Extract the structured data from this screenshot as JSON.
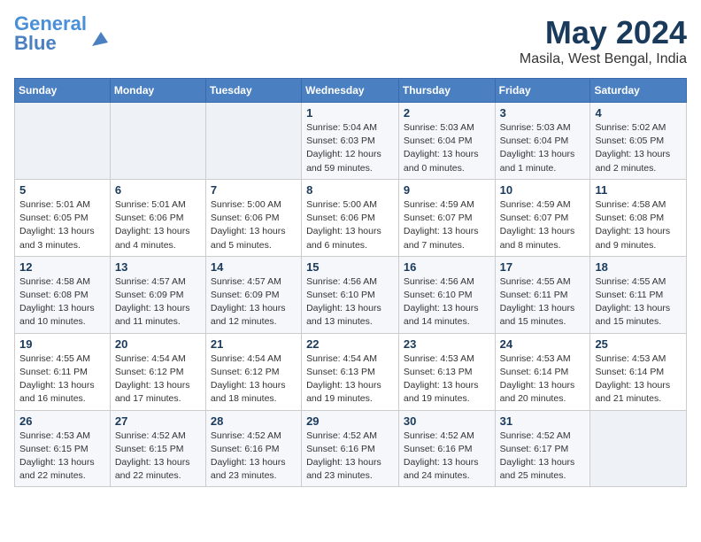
{
  "header": {
    "logo_line1": "General",
    "logo_line2": "Blue",
    "month": "May 2024",
    "location": "Masila, West Bengal, India"
  },
  "days_of_week": [
    "Sunday",
    "Monday",
    "Tuesday",
    "Wednesday",
    "Thursday",
    "Friday",
    "Saturday"
  ],
  "weeks": [
    [
      {
        "day": "",
        "info": ""
      },
      {
        "day": "",
        "info": ""
      },
      {
        "day": "",
        "info": ""
      },
      {
        "day": "1",
        "info": "Sunrise: 5:04 AM\nSunset: 6:03 PM\nDaylight: 12 hours\nand 59 minutes."
      },
      {
        "day": "2",
        "info": "Sunrise: 5:03 AM\nSunset: 6:04 PM\nDaylight: 13 hours\nand 0 minutes."
      },
      {
        "day": "3",
        "info": "Sunrise: 5:03 AM\nSunset: 6:04 PM\nDaylight: 13 hours\nand 1 minute."
      },
      {
        "day": "4",
        "info": "Sunrise: 5:02 AM\nSunset: 6:05 PM\nDaylight: 13 hours\nand 2 minutes."
      }
    ],
    [
      {
        "day": "5",
        "info": "Sunrise: 5:01 AM\nSunset: 6:05 PM\nDaylight: 13 hours\nand 3 minutes."
      },
      {
        "day": "6",
        "info": "Sunrise: 5:01 AM\nSunset: 6:06 PM\nDaylight: 13 hours\nand 4 minutes."
      },
      {
        "day": "7",
        "info": "Sunrise: 5:00 AM\nSunset: 6:06 PM\nDaylight: 13 hours\nand 5 minutes."
      },
      {
        "day": "8",
        "info": "Sunrise: 5:00 AM\nSunset: 6:06 PM\nDaylight: 13 hours\nand 6 minutes."
      },
      {
        "day": "9",
        "info": "Sunrise: 4:59 AM\nSunset: 6:07 PM\nDaylight: 13 hours\nand 7 minutes."
      },
      {
        "day": "10",
        "info": "Sunrise: 4:59 AM\nSunset: 6:07 PM\nDaylight: 13 hours\nand 8 minutes."
      },
      {
        "day": "11",
        "info": "Sunrise: 4:58 AM\nSunset: 6:08 PM\nDaylight: 13 hours\nand 9 minutes."
      }
    ],
    [
      {
        "day": "12",
        "info": "Sunrise: 4:58 AM\nSunset: 6:08 PM\nDaylight: 13 hours\nand 10 minutes."
      },
      {
        "day": "13",
        "info": "Sunrise: 4:57 AM\nSunset: 6:09 PM\nDaylight: 13 hours\nand 11 minutes."
      },
      {
        "day": "14",
        "info": "Sunrise: 4:57 AM\nSunset: 6:09 PM\nDaylight: 13 hours\nand 12 minutes."
      },
      {
        "day": "15",
        "info": "Sunrise: 4:56 AM\nSunset: 6:10 PM\nDaylight: 13 hours\nand 13 minutes."
      },
      {
        "day": "16",
        "info": "Sunrise: 4:56 AM\nSunset: 6:10 PM\nDaylight: 13 hours\nand 14 minutes."
      },
      {
        "day": "17",
        "info": "Sunrise: 4:55 AM\nSunset: 6:11 PM\nDaylight: 13 hours\nand 15 minutes."
      },
      {
        "day": "18",
        "info": "Sunrise: 4:55 AM\nSunset: 6:11 PM\nDaylight: 13 hours\nand 15 minutes."
      }
    ],
    [
      {
        "day": "19",
        "info": "Sunrise: 4:55 AM\nSunset: 6:11 PM\nDaylight: 13 hours\nand 16 minutes."
      },
      {
        "day": "20",
        "info": "Sunrise: 4:54 AM\nSunset: 6:12 PM\nDaylight: 13 hours\nand 17 minutes."
      },
      {
        "day": "21",
        "info": "Sunrise: 4:54 AM\nSunset: 6:12 PM\nDaylight: 13 hours\nand 18 minutes."
      },
      {
        "day": "22",
        "info": "Sunrise: 4:54 AM\nSunset: 6:13 PM\nDaylight: 13 hours\nand 19 minutes."
      },
      {
        "day": "23",
        "info": "Sunrise: 4:53 AM\nSunset: 6:13 PM\nDaylight: 13 hours\nand 19 minutes."
      },
      {
        "day": "24",
        "info": "Sunrise: 4:53 AM\nSunset: 6:14 PM\nDaylight: 13 hours\nand 20 minutes."
      },
      {
        "day": "25",
        "info": "Sunrise: 4:53 AM\nSunset: 6:14 PM\nDaylight: 13 hours\nand 21 minutes."
      }
    ],
    [
      {
        "day": "26",
        "info": "Sunrise: 4:53 AM\nSunset: 6:15 PM\nDaylight: 13 hours\nand 22 minutes."
      },
      {
        "day": "27",
        "info": "Sunrise: 4:52 AM\nSunset: 6:15 PM\nDaylight: 13 hours\nand 22 minutes."
      },
      {
        "day": "28",
        "info": "Sunrise: 4:52 AM\nSunset: 6:16 PM\nDaylight: 13 hours\nand 23 minutes."
      },
      {
        "day": "29",
        "info": "Sunrise: 4:52 AM\nSunset: 6:16 PM\nDaylight: 13 hours\nand 23 minutes."
      },
      {
        "day": "30",
        "info": "Sunrise: 4:52 AM\nSunset: 6:16 PM\nDaylight: 13 hours\nand 24 minutes."
      },
      {
        "day": "31",
        "info": "Sunrise: 4:52 AM\nSunset: 6:17 PM\nDaylight: 13 hours\nand 25 minutes."
      },
      {
        "day": "",
        "info": ""
      }
    ]
  ]
}
